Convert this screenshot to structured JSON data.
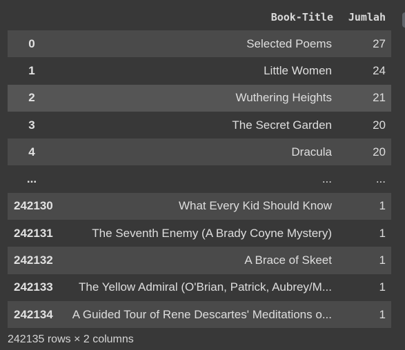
{
  "columns": {
    "index": "",
    "title": "Book-Title",
    "count": "Jumlah"
  },
  "rows": [
    {
      "index": "0",
      "title": "Selected Poems",
      "count": "27"
    },
    {
      "index": "1",
      "title": "Little Women",
      "count": "24"
    },
    {
      "index": "2",
      "title": "Wuthering Heights",
      "count": "21"
    },
    {
      "index": "3",
      "title": "The Secret Garden",
      "count": "20"
    },
    {
      "index": "4",
      "title": "Dracula",
      "count": "20"
    },
    {
      "index": "...",
      "title": "...",
      "count": "..."
    },
    {
      "index": "242130",
      "title": "What Every Kid Should Know",
      "count": "1"
    },
    {
      "index": "242131",
      "title": "The Seventh Enemy (A Brady Coyne Mystery)",
      "count": "1"
    },
    {
      "index": "242132",
      "title": "A Brace of Skeet",
      "count": "1"
    },
    {
      "index": "242133",
      "title": "The Yellow Admiral (O'Brian, Patrick, Aubrey/M...",
      "count": "1"
    },
    {
      "index": "242134",
      "title": "A Guided Tour of Rene Descartes' Meditations o...",
      "count": "1"
    }
  ],
  "footer": "242135 rows × 2 columns",
  "colors": {
    "background": "#383838",
    "stripe": "#4a4a4a",
    "hover": "#555555",
    "text": "#d5d5d5"
  }
}
